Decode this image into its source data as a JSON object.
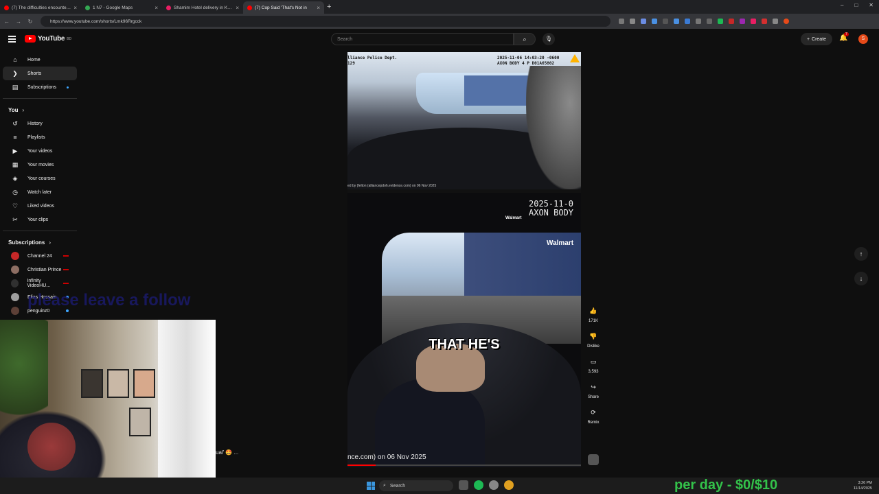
{
  "browser": {
    "tabs": [
      {
        "title": "(7) The difficulties encountered",
        "color": "#ff0000",
        "active": false
      },
      {
        "title": "1 N7 - Google Maps",
        "color": "#34a853",
        "active": false
      },
      {
        "title": "Shamim Hotel delivery in Khulna",
        "color": "#e91e63",
        "active": false
      },
      {
        "title": "(7) Cop Said 'That's Not in",
        "color": "#ff0000",
        "active": true
      }
    ],
    "new_tab": "+",
    "url": "https://www.youtube.com/shorts/Lmk96Rrgcck",
    "window_controls": [
      "–",
      "□",
      "✕"
    ]
  },
  "youtube": {
    "logo_text": "YouTube",
    "logo_country": "BD",
    "search_placeholder": "Search",
    "create_label": "Create",
    "notification_count": "7",
    "avatar_letter": "S"
  },
  "sidebar": {
    "main": [
      {
        "label": "Home",
        "icon": "home-icon",
        "glyph": "⌂"
      },
      {
        "label": "Shorts",
        "icon": "shorts-icon",
        "glyph": "❯",
        "active": true
      },
      {
        "label": "Subscriptions",
        "icon": "subscriptions-icon",
        "glyph": "▤"
      }
    ],
    "you_heading": "You",
    "you": [
      {
        "label": "History",
        "icon": "history-icon",
        "glyph": "↺"
      },
      {
        "label": "Playlists",
        "icon": "playlists-icon",
        "glyph": "≡"
      },
      {
        "label": "Your videos",
        "icon": "your-videos-icon",
        "glyph": "▶"
      },
      {
        "label": "Your movies",
        "icon": "your-movies-icon",
        "glyph": "▦"
      },
      {
        "label": "Your courses",
        "icon": "your-courses-icon",
        "glyph": "◈"
      },
      {
        "label": "Watch later",
        "icon": "watch-later-icon",
        "glyph": "◷"
      },
      {
        "label": "Liked videos",
        "icon": "liked-videos-icon",
        "glyph": "♡"
      },
      {
        "label": "Your clips",
        "icon": "clips-icon",
        "glyph": "✂"
      }
    ],
    "subscriptions_heading": "Subscriptions",
    "subscriptions": [
      {
        "label": "Channel 24",
        "color": "#c62828",
        "status": "live"
      },
      {
        "label": "Christian Prince",
        "color": "#8d6e63",
        "status": "live"
      },
      {
        "label": "Infinity VideoHU...",
        "color": "#303030",
        "status": "live"
      },
      {
        "label": "Elias Hossain",
        "color": "#9e9e9e",
        "status": "new"
      },
      {
        "label": "penguinz0",
        "color": "#5d4037",
        "status": "new"
      }
    ]
  },
  "stream_overlay": {
    "follow_text": "please leave a follow",
    "chat_snippet": "ual' 🤩 ..."
  },
  "video": {
    "top_agency": "lliance Police Dept.",
    "top_id": "129",
    "top_timestamp": "2025-11-06 14:03:20 -0600",
    "top_device": "AXON BODY 4 P D01A65802",
    "top_watermark": "ed by (felton (alliancepdoh.evidence.com) on 06 Nov 2025",
    "stamp_line1": "2025-11-0",
    "stamp_line2": "AXON BODY",
    "store_sign": "Walmart",
    "caption": "THAT HE'S",
    "bottom_watermark": "nce.com) on 06 Nov 2025",
    "progress": 0.12
  },
  "actions": [
    {
      "label": "171K",
      "icon": "like-icon",
      "glyph": "👍"
    },
    {
      "label": "Dislike",
      "icon": "dislike-icon",
      "glyph": "👎"
    },
    {
      "label": "3,593",
      "icon": "comments-icon",
      "glyph": "▭"
    },
    {
      "label": "Share",
      "icon": "share-icon",
      "glyph": "↪"
    },
    {
      "label": "Remix",
      "icon": "remix-icon",
      "glyph": "⟳"
    }
  ],
  "nav": {
    "up": "↑",
    "down": "↓"
  },
  "taskbar": {
    "search_label": "Search",
    "time": "3:26 PM",
    "date": "11/14/2025",
    "goal_text": "per day - $0/$10"
  }
}
